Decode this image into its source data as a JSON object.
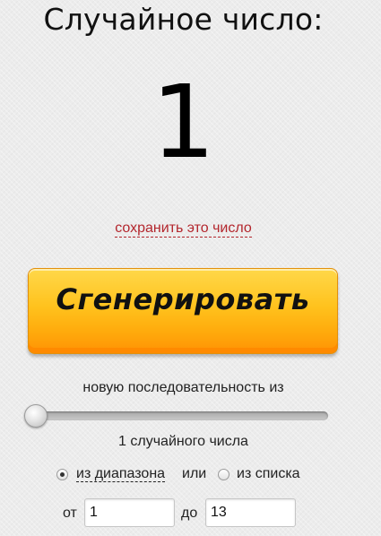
{
  "header": {
    "title": "Случайное число:"
  },
  "result": {
    "value": "1",
    "save_link": "сохранить это число"
  },
  "generate_button": {
    "label": "Сгенерировать",
    "colors": {
      "top": "#ffd84a",
      "bottom": "#ff9204"
    }
  },
  "sequence": {
    "label": "новую последовательность из",
    "slider_value": 1,
    "count_label": "1 случайного числа"
  },
  "mode": {
    "option_range": "из диапазона",
    "separator": "или",
    "option_list": "из списка",
    "selected": "range"
  },
  "range": {
    "from_label": "от",
    "from_value": "1",
    "to_label": "до",
    "to_value": "13"
  },
  "colors": {
    "link": "#b3262d",
    "background": "#ececec"
  }
}
